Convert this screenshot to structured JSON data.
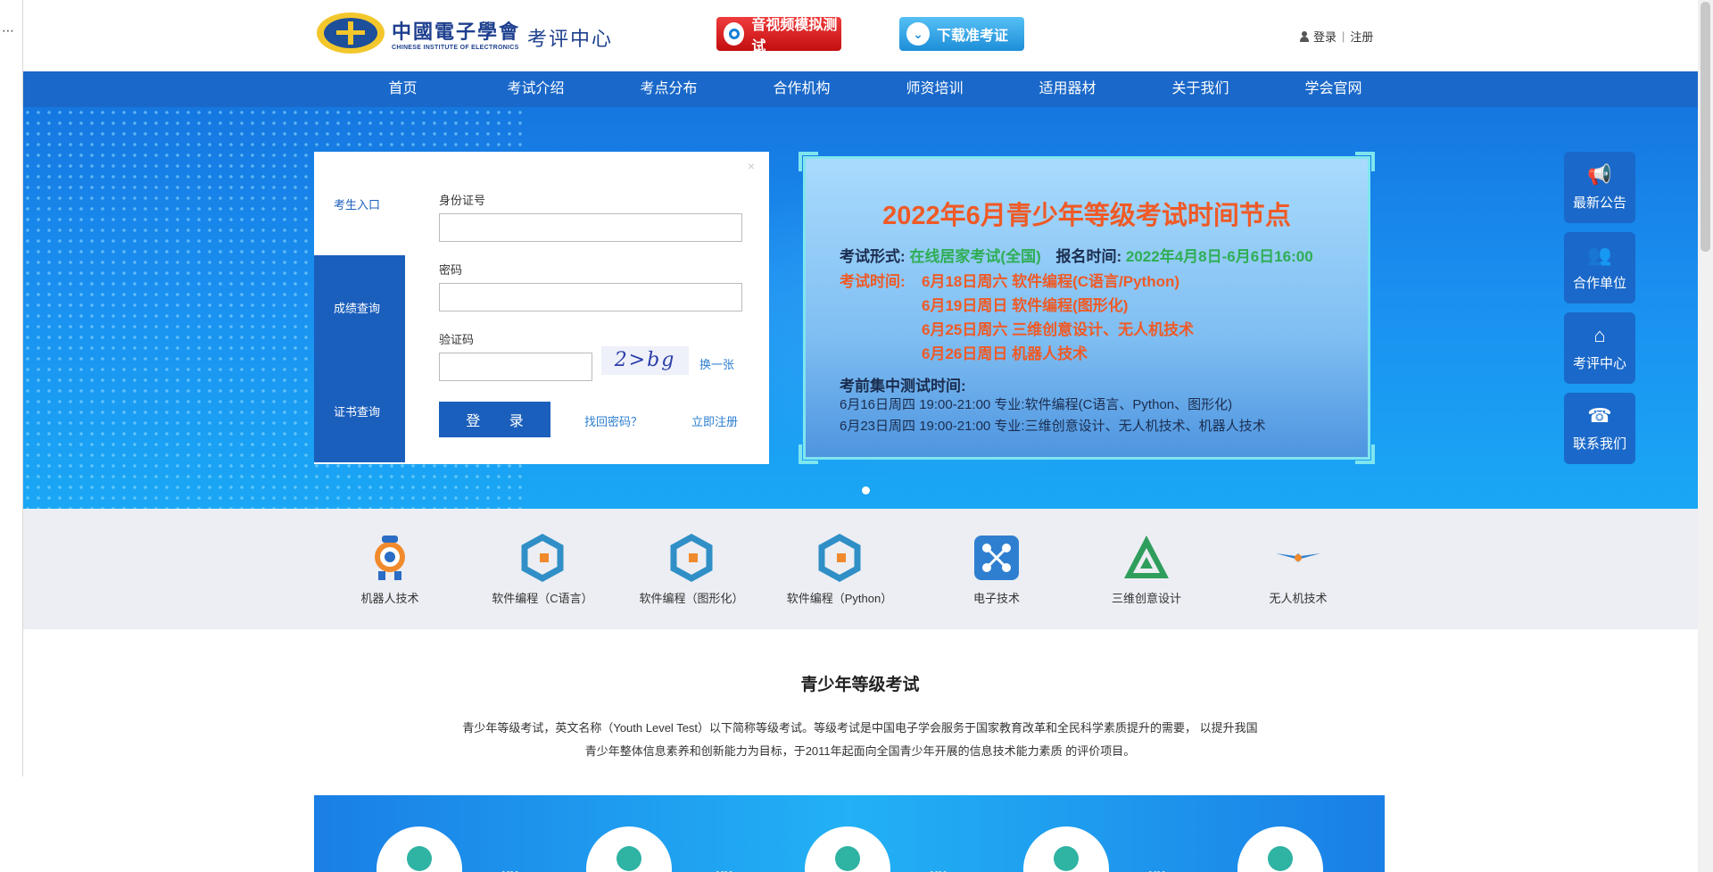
{
  "header": {
    "logo_cn": "中國電子學會",
    "logo_en": "CHINESE INSTITUTE OF ELECTRONICS",
    "logo_sub": "考评中心",
    "av_test_button": "音视频模拟测试",
    "download_button": "下载准考证",
    "login": "登录",
    "register": "注册"
  },
  "nav": [
    "首页",
    "考试介绍",
    "考点分布",
    "合作机构",
    "师资培训",
    "适用器材",
    "关于我们",
    "学会官网"
  ],
  "login_panel": {
    "tabs": [
      "考生入口",
      "成绩查询",
      "证书查询"
    ],
    "id_label": "身份证号",
    "password_label": "密码",
    "captcha_label": "验证码",
    "captcha_text": "2>bg",
    "refresh": "换一张",
    "submit": "登 录",
    "forgot": "找回密码？",
    "register": "立即注册",
    "close": "×"
  },
  "notice": {
    "title": "2022年6月青少年等级考试时间节点",
    "form_label": "考试形式:",
    "form_value": "在线居家考试(全国)",
    "reg_label": "报名时间:",
    "reg_value": "2022年4月8日-6月6日16:00",
    "time_label": "考试时间:",
    "exam_1": "6月18日周六  软件编程(C语言/Python)",
    "exam_2": "6月19日周日  软件编程(图形化)",
    "exam_3": "6月25日周六  三维创意设计、无人机技术",
    "exam_4": "6月26日周日  机器人技术",
    "pretest_label": "考前集中测试时间:",
    "pretest_1": "6月16日周四  19:00-21:00  专业:软件编程(C语言、Python、图形化)",
    "pretest_2": "6月23日周四  19:00-21:00  专业:三维创意设计、无人机技术、机器人技术"
  },
  "side_buttons": [
    {
      "label": "最新公告",
      "icon": "megaphone-icon"
    },
    {
      "label": "合作单位",
      "icon": "partners-icon"
    },
    {
      "label": "考评中心",
      "icon": "home-icon"
    },
    {
      "label": "联系我们",
      "icon": "phone-24-icon"
    }
  ],
  "categories": [
    {
      "label": "机器人技术",
      "icon": "robot-icon"
    },
    {
      "label": "软件编程（C语言）",
      "icon": "code-c-icon"
    },
    {
      "label": "软件编程（图形化）",
      "icon": "code-graphic-icon"
    },
    {
      "label": "软件编程（Python）",
      "icon": "code-python-icon"
    },
    {
      "label": "电子技术",
      "icon": "circuit-icon"
    },
    {
      "label": "三维创意设计",
      "icon": "3d-design-icon"
    },
    {
      "label": "无人机技术",
      "icon": "drone-icon"
    }
  ],
  "intro": {
    "title": "青少年等级考试",
    "p1": "青少年等级考试，英文名称（Youth Level Test）以下简称等级考试。等级考试是中国电子学会服务于国家教育改革和全民科学素质提升的需要， 以提升我国",
    "p2": "青少年整体信息素养和创新能力为目标，于2011年起面向全国青少年开展的信息技术能力素质 的评价项目。"
  },
  "colors": {
    "nav_blue": "#1a68c9",
    "notice_orange": "#ef5a26",
    "notice_green": "#2fae55",
    "av_red": "#d9191a"
  }
}
